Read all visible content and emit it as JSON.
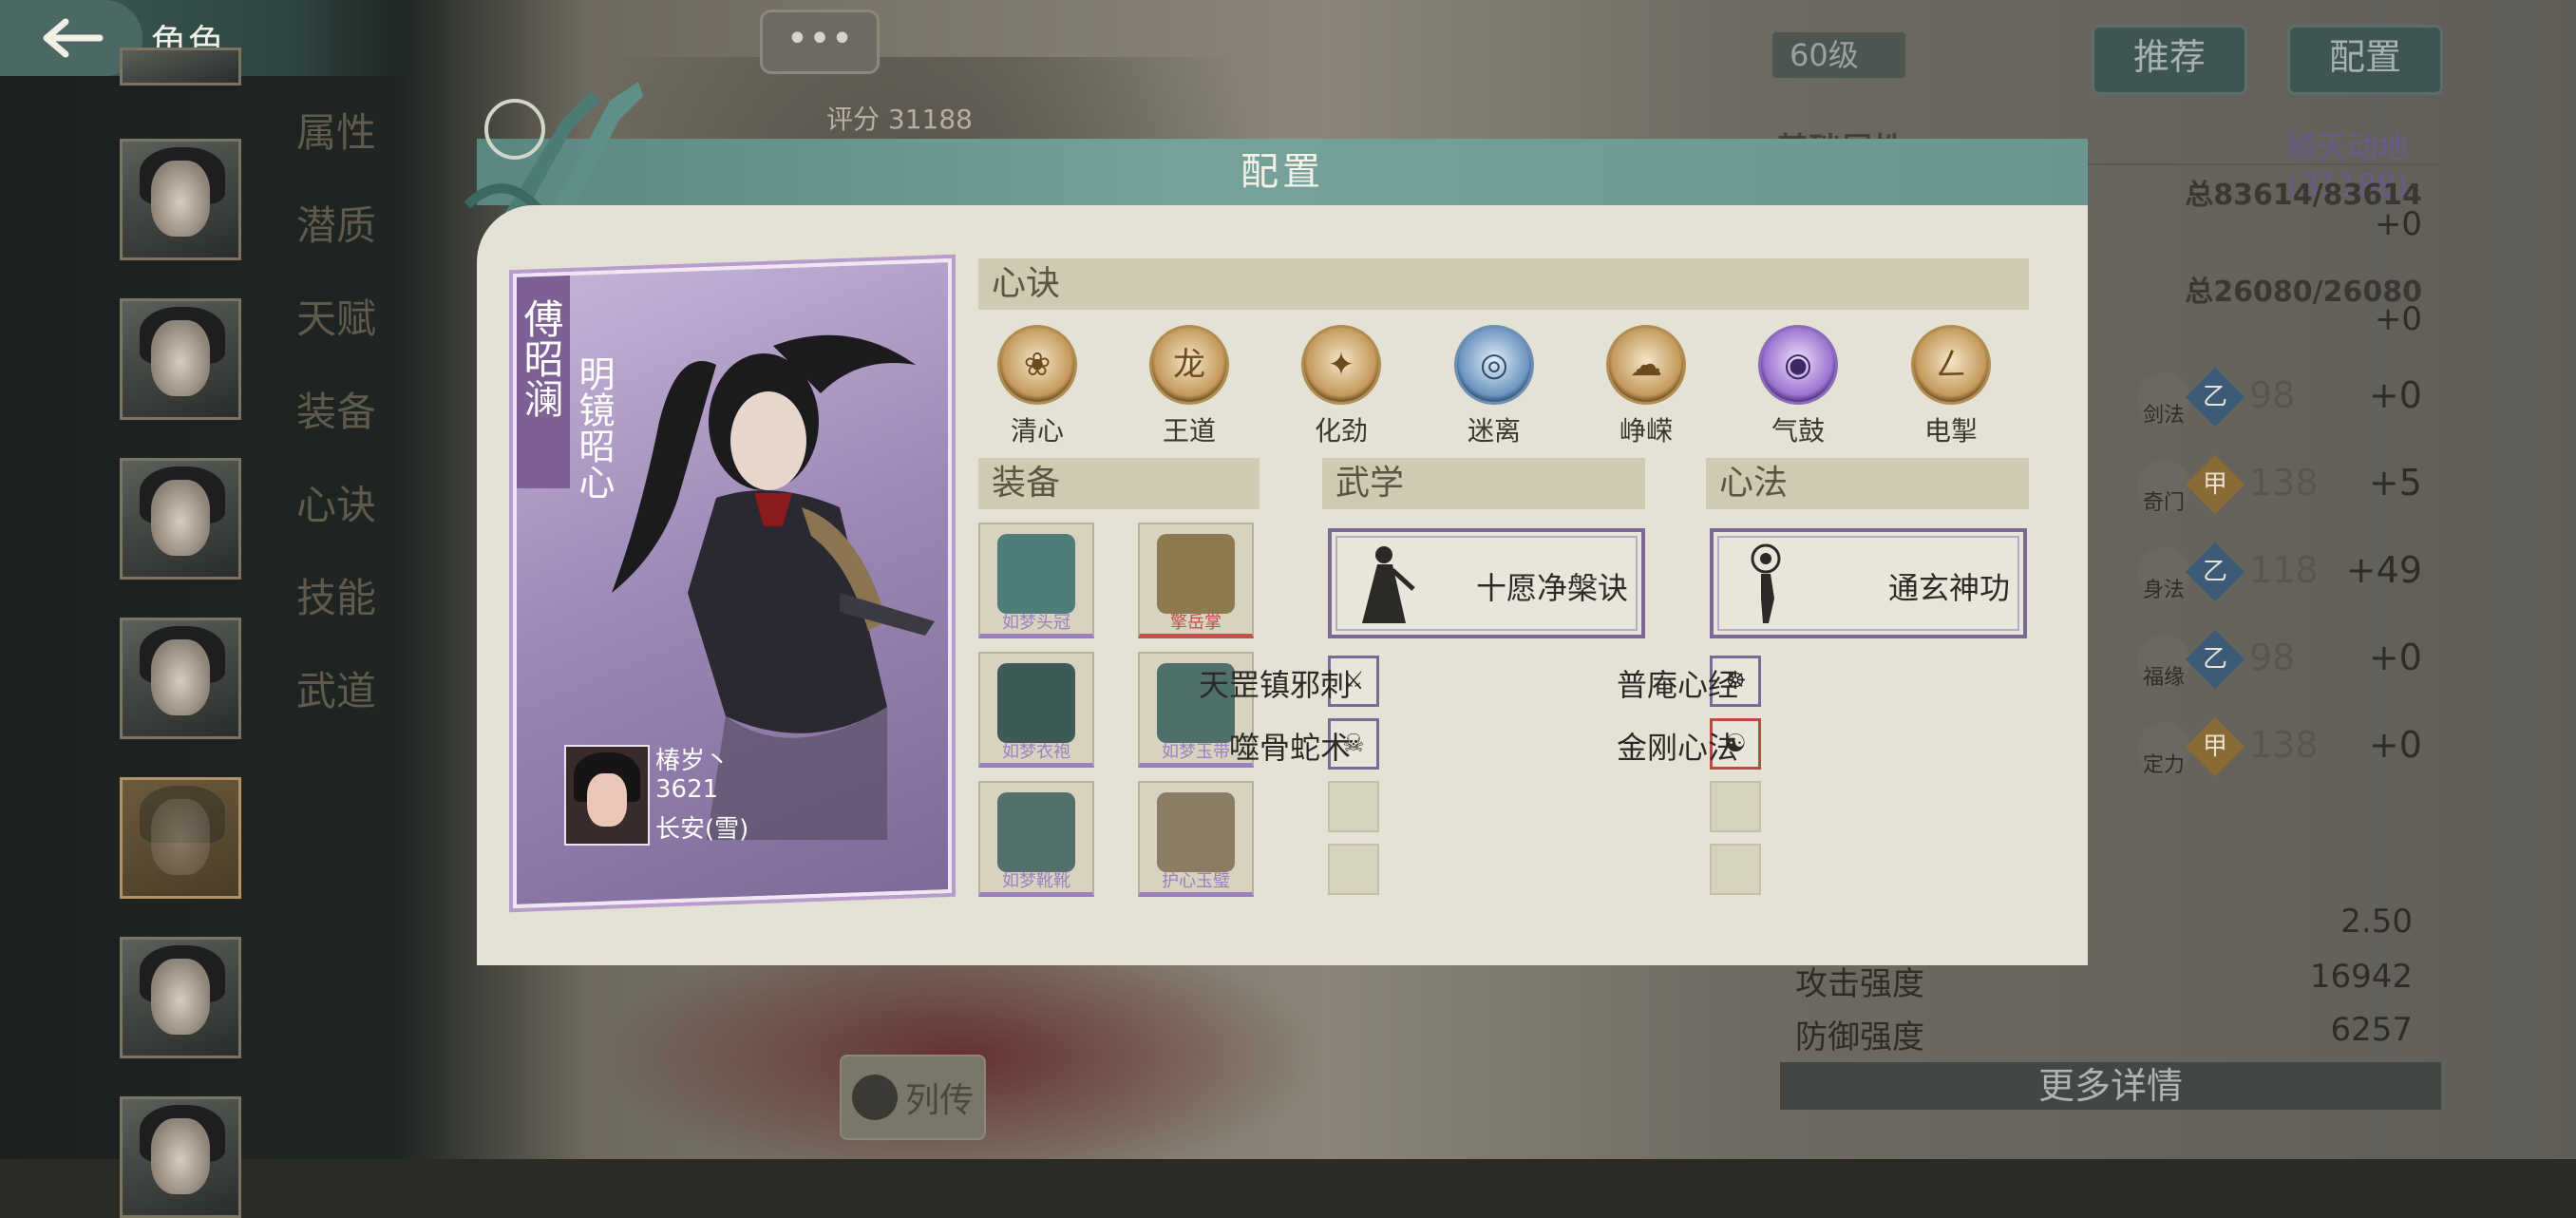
{
  "topbar": {
    "title": "角色"
  },
  "side_tabs": [
    "属性",
    "潜质",
    "天赋",
    "装备",
    "心诀",
    "技能",
    "武道"
  ],
  "background": {
    "more_label": "•••",
    "score_label": "评分 31188",
    "biography_label": "列传",
    "level": "60级",
    "recommend_label": "推荐",
    "config_label": "配置",
    "base_attr_label": "基础属性",
    "skill_name": "撼天动地(31188)",
    "totals": [
      {
        "total": "总83614/83614",
        "plus": "+0"
      },
      {
        "total": "总26080/26080",
        "plus": "+0"
      }
    ],
    "attrs": [
      {
        "name": "剑法",
        "badge": "乙",
        "value": "98",
        "plus": "+0"
      },
      {
        "name": "奇门",
        "badge": "甲",
        "value": "138",
        "plus": "+5"
      },
      {
        "name": "身法",
        "badge": "乙",
        "value": "118",
        "plus": "+49"
      },
      {
        "name": "福缘",
        "badge": "乙",
        "value": "98",
        "plus": "+0"
      },
      {
        "name": "定力",
        "badge": "甲",
        "value": "138",
        "plus": "+0"
      }
    ],
    "lower_stats": [
      {
        "label": "",
        "value": "2.50"
      },
      {
        "label": "攻击强度",
        "value": "16942"
      },
      {
        "label": "防御强度",
        "value": "6257"
      }
    ],
    "more_detail": "更多详情"
  },
  "modal": {
    "title": "配置",
    "character": {
      "name": "傅昭澜",
      "title": "明镜昭心",
      "player_name": "椿岁丶",
      "player_id": "3621",
      "server": "长安(雪)"
    },
    "xinjue": {
      "header": "心诀",
      "items": [
        {
          "label": "清心",
          "icon": "lotus-icon",
          "glyph": "❀",
          "tone": "gold"
        },
        {
          "label": "王道",
          "icon": "dragon-icon",
          "glyph": "龙",
          "tone": "gold"
        },
        {
          "label": "化劲",
          "icon": "swirl-icon",
          "glyph": "✦",
          "tone": "gold"
        },
        {
          "label": "迷离",
          "icon": "mist-icon",
          "glyph": "◎",
          "tone": "blue"
        },
        {
          "label": "峥嵘",
          "icon": "cloud-icon",
          "glyph": "☁",
          "tone": "gold"
        },
        {
          "label": "气鼓",
          "icon": "vortex-icon",
          "glyph": "◉",
          "tone": "purple"
        },
        {
          "label": "电掣",
          "icon": "lightning-icon",
          "glyph": "ㄥ",
          "tone": "gold"
        }
      ]
    },
    "equipment": {
      "header": "装备",
      "items": [
        {
          "label": "如梦头冠",
          "tone": "purple",
          "color": "#4f7d7a"
        },
        {
          "label": "擎岳掌",
          "tone": "red",
          "color": "#8e7a4f"
        },
        {
          "label": "如梦衣袍",
          "tone": "purple",
          "color": "#3e5a56"
        },
        {
          "label": "如梦玉带",
          "tone": "purple",
          "color": "#4e6f6a"
        },
        {
          "label": "如梦靴靴",
          "tone": "purple",
          "color": "#54706a"
        },
        {
          "label": "护心玉璧",
          "tone": "purple",
          "color": "#8a7d63"
        }
      ]
    },
    "wuxue": {
      "header": "武学",
      "main": "十愿净槃诀",
      "subs": [
        "天罡镇邪刺",
        "噬骨蛇术"
      ]
    },
    "xinfa": {
      "header": "心法",
      "main": "通玄神功",
      "subs": [
        "普庵心经",
        "金刚心法"
      ]
    },
    "colors": {
      "header": "#6b958f",
      "panel": "#e4e2d4",
      "purple_border": "#7c6a96"
    }
  }
}
